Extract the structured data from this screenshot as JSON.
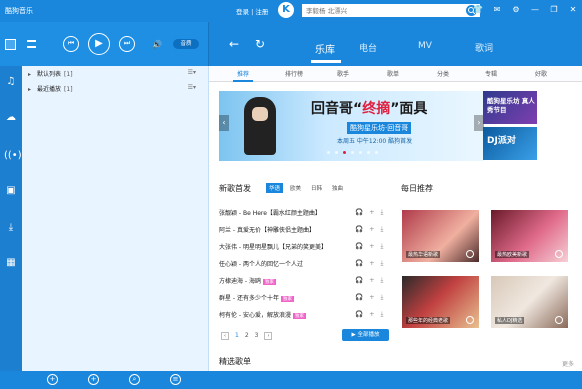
{
  "titlebar": {
    "app_title": "酷狗音乐",
    "login_label": "登录 | 注册",
    "logo_letter": "K",
    "search_placeholder": "李毅杨 北漂兴",
    "window_buttons": [
      "shirt-icon",
      "mail-icon",
      "settings-icon",
      "minimize-icon",
      "restore-icon",
      "close-icon"
    ]
  },
  "player": {
    "volume_mode": "音质"
  },
  "nav": {
    "tabs": [
      {
        "label": "乐库",
        "active": true
      },
      {
        "label": "电台",
        "active": false
      },
      {
        "label": "MV",
        "active": false
      },
      {
        "label": "歌词",
        "active": false
      }
    ]
  },
  "rail_icons": [
    "music-note-icon",
    "cloud-icon",
    "radio-icon",
    "phone-transfer-icon",
    "download-icon",
    "apps-icon"
  ],
  "playlists": [
    {
      "name": "默认列表",
      "count": "[1]"
    },
    {
      "name": "最近播放",
      "count": "[1]"
    }
  ],
  "subtabs": [
    {
      "label": "推荐",
      "active": true
    },
    {
      "label": "排行榜",
      "active": false
    },
    {
      "label": "歌手",
      "active": false
    },
    {
      "label": "歌单",
      "active": false
    },
    {
      "label": "分类",
      "active": false
    },
    {
      "label": "专辑",
      "active": false
    },
    {
      "label": "好歌",
      "active": false
    }
  ],
  "banner": {
    "headline_pre": "回音哥“",
    "headline_em": "终摘",
    "headline_post": "”面具",
    "subtitle": "酷狗星乐坊·回音哥",
    "schedule": "本周五 中午12:00 酷狗首发"
  },
  "promos": [
    {
      "label": "酷狗星乐坊 真人秀节目"
    },
    {
      "label": "DJ派对"
    }
  ],
  "new_songs": {
    "title": "新歌首发",
    "tabs": [
      {
        "label": "华语",
        "active": true
      },
      {
        "label": "欧美",
        "active": false
      },
      {
        "label": "日韩",
        "active": false
      },
      {
        "label": "独曲",
        "active": false
      }
    ],
    "songs": [
      {
        "title": "张靓颖 - Be Here【霸水红颜主题曲】",
        "badge": ""
      },
      {
        "title": "阿兰 - 真爱无价【神雕侠侣主题曲】",
        "badge": ""
      },
      {
        "title": "大张伟 - 明星明星飘儿【兄弟的笑更美】",
        "badge": ""
      },
      {
        "title": "任心颖 - 两个人的回忆一个人过",
        "badge": ""
      },
      {
        "title": "方棣迪海 - 海鸥",
        "badge": "独家"
      },
      {
        "title": "群星 - 还有多少个十年",
        "badge": "独家"
      },
      {
        "title": "柯有伦 - 安心爱，解放浪漫",
        "badge": "独家"
      }
    ],
    "pages": [
      "1",
      "2",
      "3"
    ],
    "play_all_label": "▶ 全部播放"
  },
  "daily": {
    "title": "每日推荐",
    "tiles": [
      {
        "caption": "最热华语新歌"
      },
      {
        "caption": "最热欧美新歌"
      },
      {
        "caption": "那些年的经典老歌"
      },
      {
        "caption": "私人DJ精选"
      }
    ]
  },
  "featured": {
    "title": "精选歌单",
    "more": "更多"
  }
}
